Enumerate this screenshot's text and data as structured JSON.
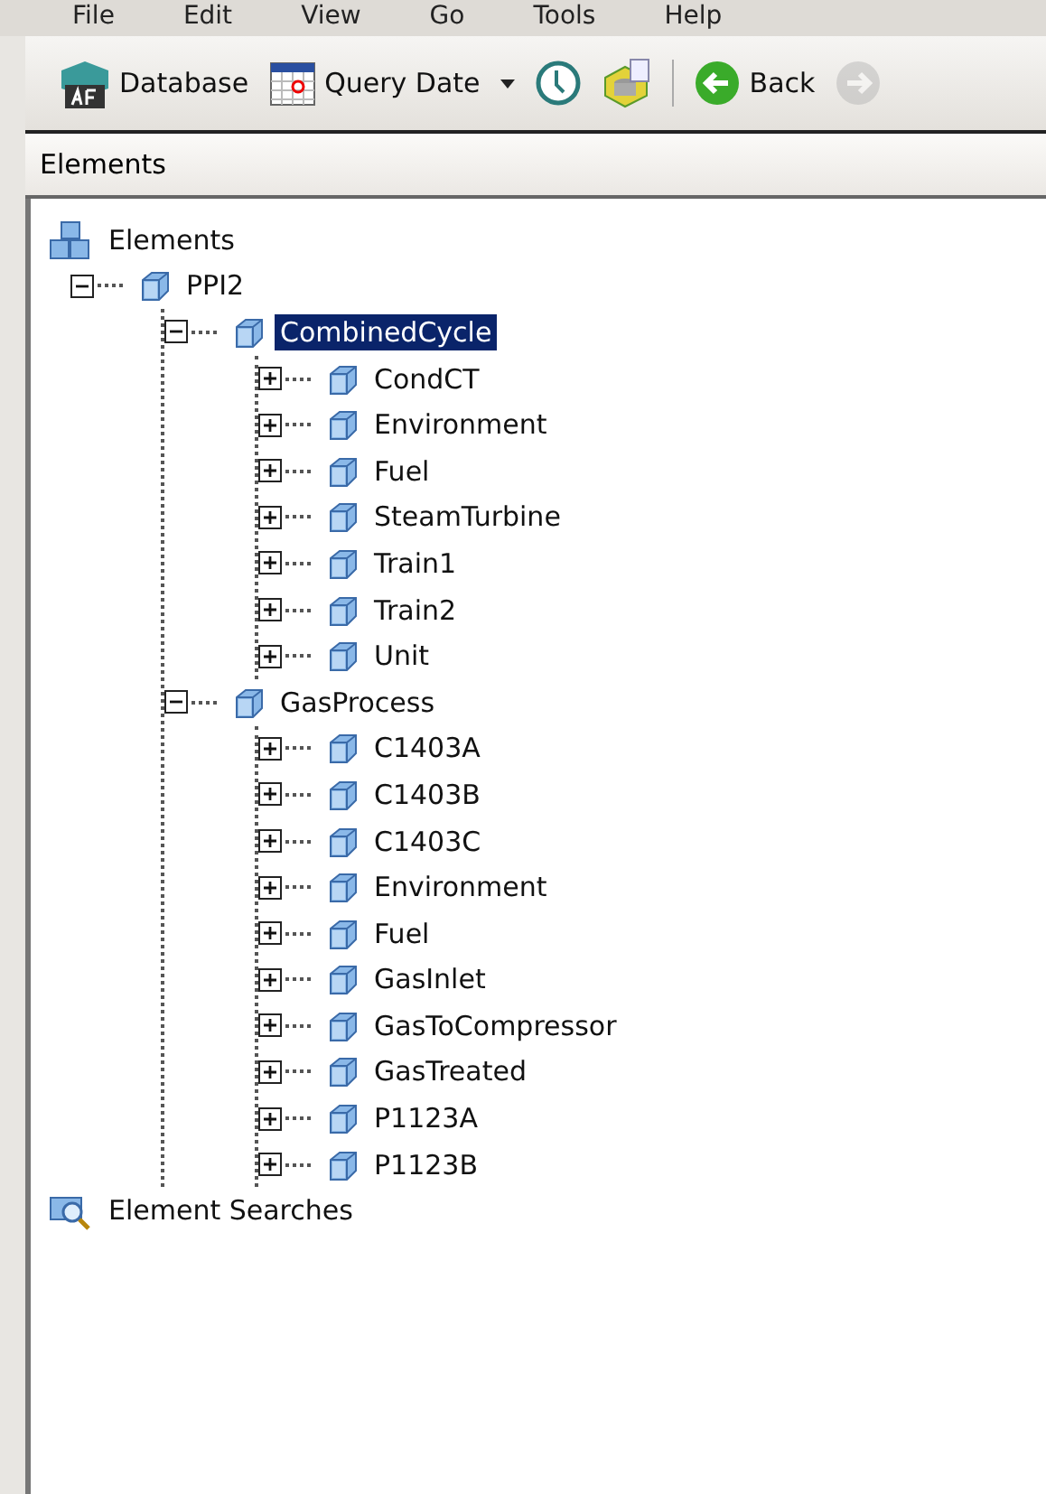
{
  "menu": [
    "File",
    "Edit",
    "View",
    "Go",
    "Tools",
    "Help"
  ],
  "toolbar": [
    {
      "kind": "button",
      "label": "Database"
    },
    {
      "kind": "button",
      "label": "Query Date"
    },
    {
      "kind": "caret"
    },
    {
      "kind": "button"
    },
    {
      "kind": "button"
    },
    {
      "kind": "separator"
    },
    {
      "kind": "button",
      "label": "Back",
      "disabled": false
    },
    {
      "kind": "button",
      "disabled": true
    }
  ],
  "panel": {
    "title": "Elements"
  },
  "tree": [
    {
      "label": "Elements",
      "kind": "root",
      "selected": false,
      "children": [
        {
          "label": "PPI2",
          "kind": "element",
          "expanded": true,
          "selected": false,
          "children": [
            {
              "label": "CombinedCycle",
              "kind": "element",
              "expanded": true,
              "selected": true,
              "children": [
                {
                  "label": "CondCT",
                  "kind": "element",
                  "expanded": false,
                  "selected": false
                },
                {
                  "label": "Environment",
                  "kind": "element",
                  "expanded": false,
                  "selected": false
                },
                {
                  "label": "Fuel",
                  "kind": "element",
                  "expanded": false,
                  "selected": false
                },
                {
                  "label": "SteamTurbine",
                  "kind": "element",
                  "expanded": false,
                  "selected": false
                },
                {
                  "label": "Train1",
                  "kind": "element",
                  "expanded": false,
                  "selected": false
                },
                {
                  "label": "Train2",
                  "kind": "element",
                  "expanded": false,
                  "selected": false
                },
                {
                  "label": "Unit",
                  "kind": "element",
                  "expanded": false,
                  "selected": false
                }
              ]
            },
            {
              "label": "GasProcess",
              "kind": "element",
              "expanded": true,
              "selected": false,
              "children": [
                {
                  "label": "C1403A",
                  "kind": "element",
                  "expanded": false,
                  "selected": false
                },
                {
                  "label": "C1403B",
                  "kind": "element",
                  "expanded": false,
                  "selected": false
                },
                {
                  "label": "C1403C",
                  "kind": "element",
                  "expanded": false,
                  "selected": false
                },
                {
                  "label": "Environment",
                  "kind": "element",
                  "expanded": false,
                  "selected": false
                },
                {
                  "label": "Fuel",
                  "kind": "element",
                  "expanded": false,
                  "selected": false
                },
                {
                  "label": "GasInlet",
                  "kind": "element",
                  "expanded": false,
                  "selected": false
                },
                {
                  "label": "GasToCompressor",
                  "kind": "element",
                  "expanded": false,
                  "selected": false
                },
                {
                  "label": "GasTreated",
                  "kind": "element",
                  "expanded": false,
                  "selected": false
                },
                {
                  "label": "P1123A",
                  "kind": "element",
                  "expanded": false,
                  "selected": false
                },
                {
                  "label": "P1123B",
                  "kind": "element",
                  "expanded": false,
                  "selected": false
                }
              ]
            }
          ]
        }
      ]
    },
    {
      "label": "Element Searches",
      "kind": "search",
      "selected": false
    }
  ]
}
